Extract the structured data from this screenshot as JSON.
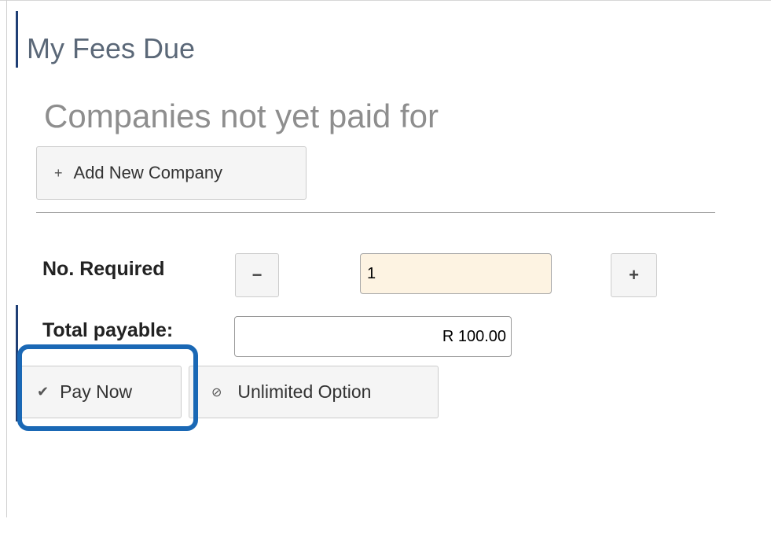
{
  "page": {
    "title": "My Fees Due"
  },
  "section": {
    "title": "Companies not yet paid for",
    "add_company_icon": "+",
    "add_company_label": "Add New Company"
  },
  "quantity": {
    "label": "No. Required",
    "minus_icon": "−",
    "plus_icon": "+",
    "value": "1"
  },
  "total": {
    "label": "Total payable:",
    "value": "R 100.00"
  },
  "actions": {
    "pay_now_icon": "✔",
    "pay_now_label": "Pay Now",
    "unlimited_icon": "⊘",
    "unlimited_label": "Unlimited Option"
  },
  "colors": {
    "accent_bar": "#1f3f75",
    "highlight": "#1a68b5",
    "quantity_input_bg": "#fdf3e2"
  }
}
